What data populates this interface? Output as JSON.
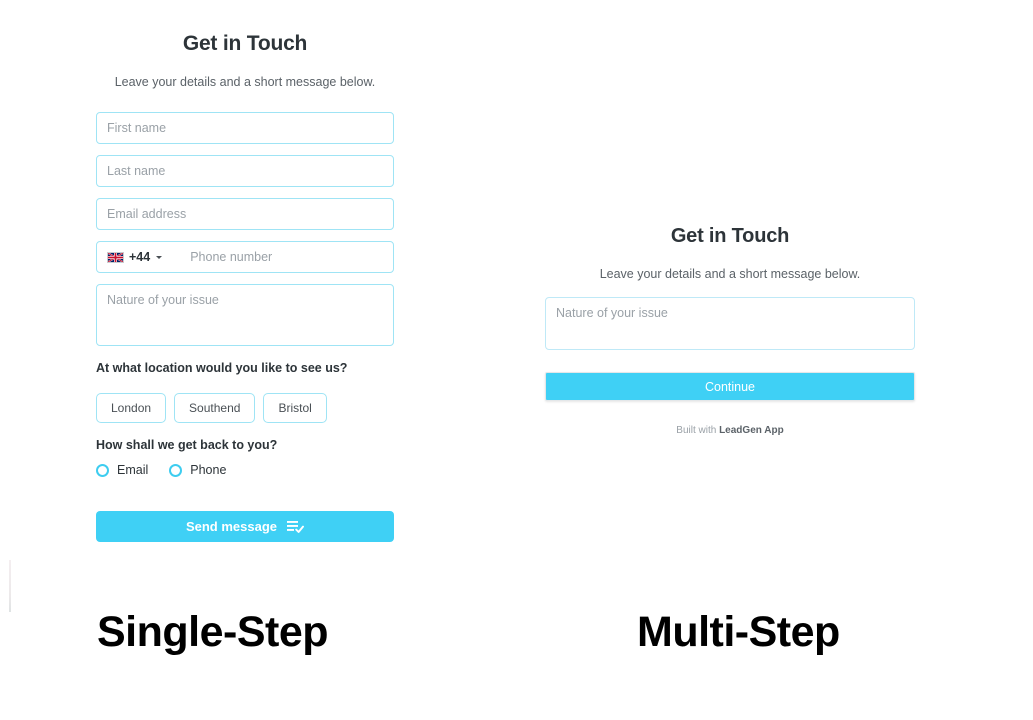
{
  "colors": {
    "accent": "#3fd0f5",
    "field_border": "#9fe4f5",
    "heading": "#2d3439",
    "muted_text": "#9aa1a7",
    "body_text": "#5b6268"
  },
  "single_step": {
    "title": "Get in Touch",
    "subtitle": "Leave your details and a short message below.",
    "fields": [
      {
        "name": "first-name",
        "placeholder": "First name"
      },
      {
        "name": "last-name",
        "placeholder": "Last name"
      },
      {
        "name": "email",
        "placeholder": "Email address"
      }
    ],
    "phone": {
      "dial_code": "+44",
      "country_flag": "uk-flag-icon",
      "placeholder": "Phone number"
    },
    "message": {
      "placeholder": "Nature of your issue"
    },
    "location_question": "At what location would you like to see us?",
    "locations": [
      "London",
      "Southend",
      "Bristol"
    ],
    "contact_question": "How shall we get back to you?",
    "contact_options": [
      "Email",
      "Phone"
    ],
    "submit_label": "Send message",
    "submit_icon": "list-check-icon"
  },
  "multi_step": {
    "title": "Get in Touch",
    "subtitle": "Leave your details and a short message below.",
    "message": {
      "placeholder": "Nature of your issue"
    },
    "continue_label": "Continue",
    "footer_prefix": "Built with ",
    "footer_brand": "LeadGen App"
  },
  "captions": {
    "single": "Single-Step",
    "multi": "Multi-Step"
  }
}
